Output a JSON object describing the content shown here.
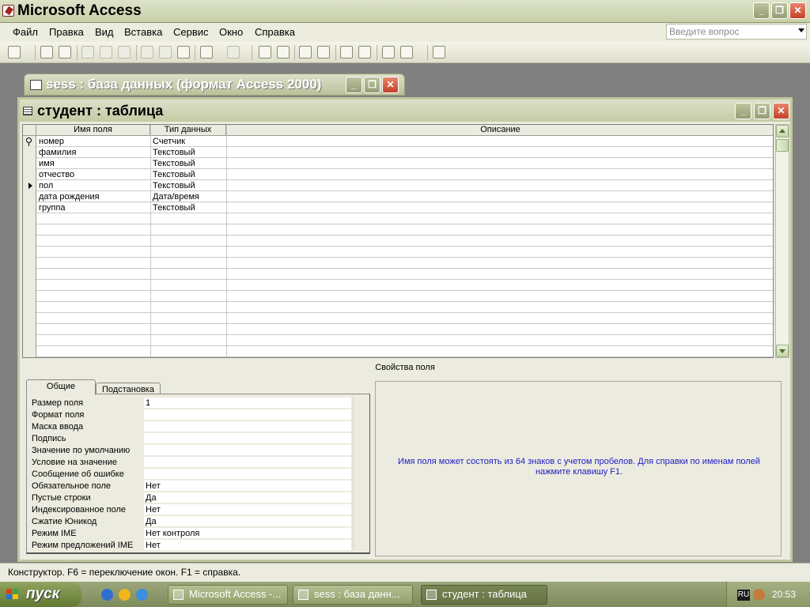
{
  "app": {
    "title": "Microsoft Access",
    "minimize": "_",
    "restore": "❐",
    "close": "✕"
  },
  "menu": {
    "items": [
      "Файл",
      "Правка",
      "Вид",
      "Вставка",
      "Сервис",
      "Окно",
      "Справка"
    ],
    "help_placeholder": "Введите вопрос"
  },
  "db_window": {
    "title": "sess : база данных (формат Access 2000)"
  },
  "table_window": {
    "title": "студент : таблица",
    "columns": [
      "Имя поля",
      "Тип данных",
      "Описание"
    ],
    "rows": [
      {
        "name": "номер",
        "type": "Счетчик",
        "indicator": "key"
      },
      {
        "name": "фамилия",
        "type": "Текстовый",
        "indicator": ""
      },
      {
        "name": "имя",
        "type": "Текстовый",
        "indicator": ""
      },
      {
        "name": "отчество",
        "type": "Текстовый",
        "indicator": ""
      },
      {
        "name": "пол",
        "type": "Текстовый",
        "indicator": "current"
      },
      {
        "name": "дата рождения",
        "type": "Дата/время",
        "indicator": ""
      },
      {
        "name": "группа",
        "type": "Текстовый",
        "indicator": ""
      }
    ],
    "empty_rows": 13
  },
  "field_properties": {
    "caption": "Свойства поля",
    "tabs": [
      "Общие",
      "Подстановка"
    ],
    "active_tab": "Общие",
    "rows": [
      {
        "label": "Размер поля",
        "value": "1"
      },
      {
        "label": "Формат поля",
        "value": ""
      },
      {
        "label": "Маска ввода",
        "value": ""
      },
      {
        "label": "Подпись",
        "value": ""
      },
      {
        "label": "Значение по умолчанию",
        "value": ""
      },
      {
        "label": "Условие на значение",
        "value": ""
      },
      {
        "label": "Сообщение об ошибке",
        "value": ""
      },
      {
        "label": "Обязательное поле",
        "value": "Нет"
      },
      {
        "label": "Пустые строки",
        "value": "Да"
      },
      {
        "label": "Индексированное поле",
        "value": "Нет"
      },
      {
        "label": "Сжатие Юникод",
        "value": "Да"
      },
      {
        "label": "Режим IME",
        "value": "Нет контроля"
      },
      {
        "label": "Режим предложений IME",
        "value": "Нет"
      }
    ],
    "help_text": "Имя поля может состоять из 64 знаков с учетом пробелов.  Для справки по именам полей нажмите клавишу F1."
  },
  "status_bar": {
    "text": "Конструктор.  F6 = переключение окон.  F1 = справка."
  },
  "taskbar": {
    "start_label": "пуск",
    "tasks": [
      {
        "label": "Microsoft Access -...",
        "active": false
      },
      {
        "label": "sess : база данн...",
        "active": false
      },
      {
        "label": "студент : таблица",
        "active": true
      }
    ],
    "lang": "RU",
    "clock": "20:53"
  },
  "colors": {
    "help_text": "#1c1cc4",
    "titlebar": "#c7cfa8",
    "taskbar": "#8b9866"
  }
}
